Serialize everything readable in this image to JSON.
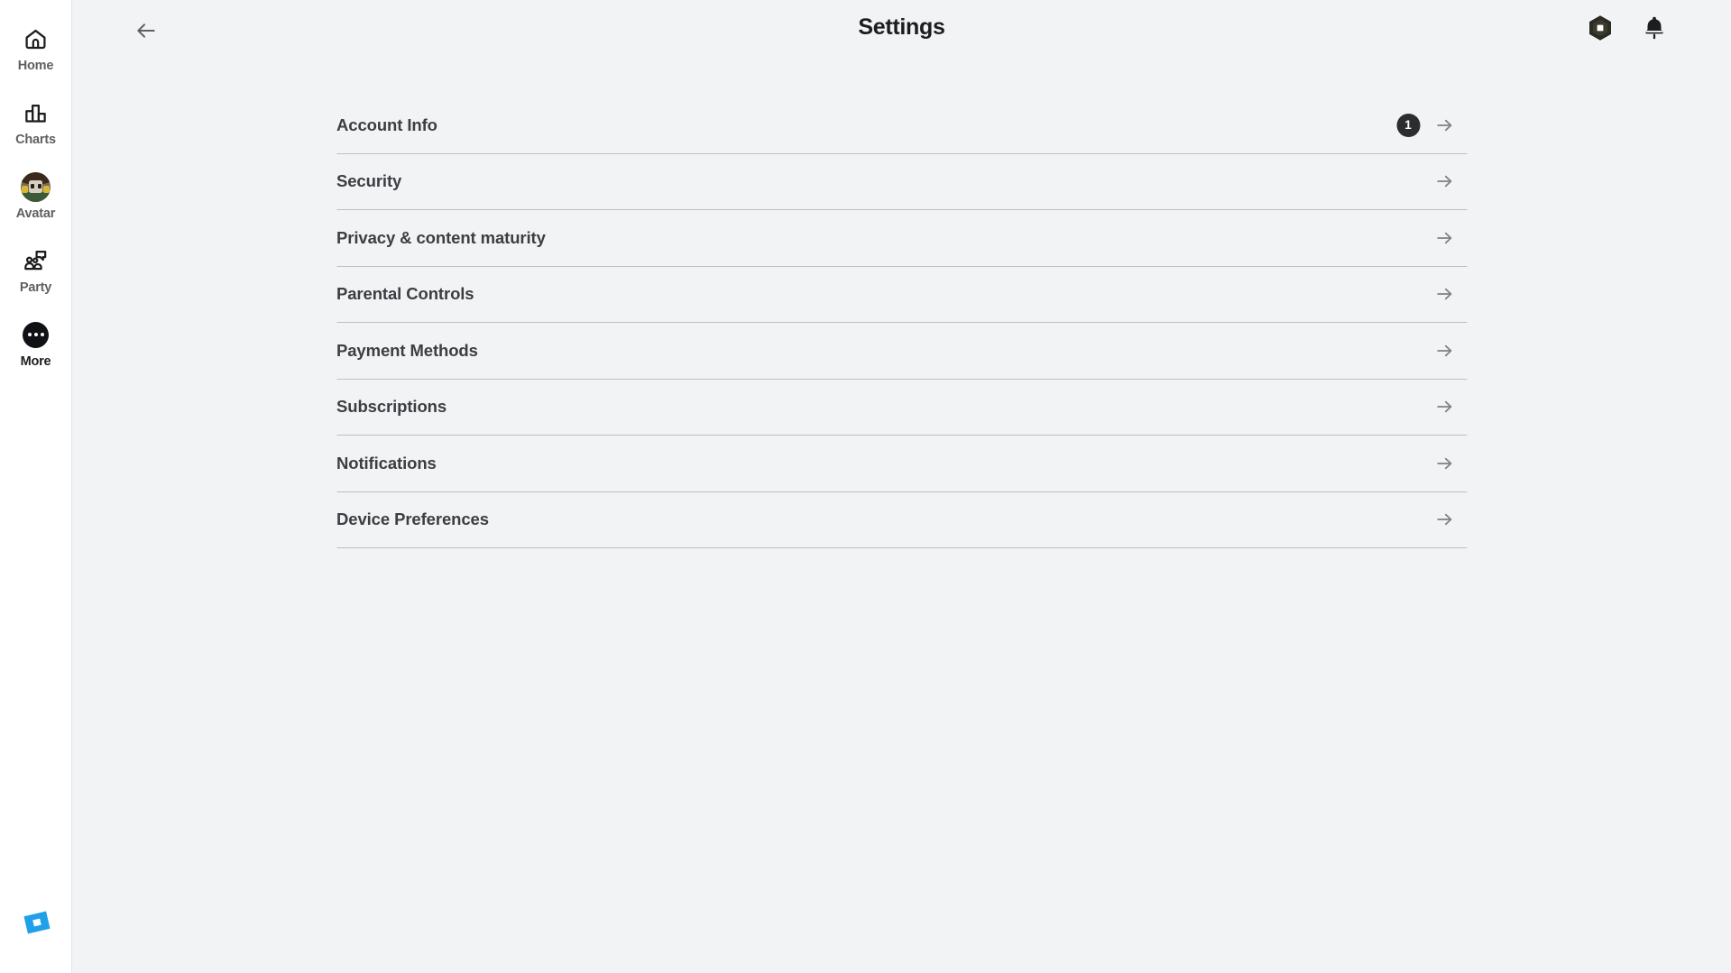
{
  "colors": {
    "page_bg": "#F2F3F4",
    "rail_bg": "#FFFFFF",
    "divider": "#BDC0C4",
    "title_text": "#1B1D1F",
    "row_text": "#3B3E42",
    "rail_label": "#5E6063",
    "badge_bg": "#2B2D30",
    "logo_blue": "#1FA0E8",
    "arrow_gray": "#7E8184"
  },
  "sidebar": {
    "items": [
      {
        "label": "Home",
        "icon": "home-icon",
        "active": false
      },
      {
        "label": "Charts",
        "icon": "charts-icon",
        "active": false
      },
      {
        "label": "Avatar",
        "icon": "avatar-icon",
        "active": false
      },
      {
        "label": "Party",
        "icon": "party-icon",
        "active": false
      },
      {
        "label": "More",
        "icon": "more-dots-icon",
        "active": true
      }
    ],
    "logo": "roblox-logo-icon"
  },
  "header": {
    "back_icon": "back-arrow-icon",
    "title": "Settings",
    "robux_icon": "robux-hexagon-icon",
    "notifications_icon": "notification-bell-icon"
  },
  "settings": {
    "rows": [
      {
        "label": "Account Info",
        "badge": "1",
        "arrow": "chevron-right-arrow-icon"
      },
      {
        "label": "Security",
        "badge": null,
        "arrow": "chevron-right-arrow-icon"
      },
      {
        "label": "Privacy & content maturity",
        "badge": null,
        "arrow": "chevron-right-arrow-icon"
      },
      {
        "label": "Parental Controls",
        "badge": null,
        "arrow": "chevron-right-arrow-icon"
      },
      {
        "label": "Payment Methods",
        "badge": null,
        "arrow": "chevron-right-arrow-icon"
      },
      {
        "label": "Subscriptions",
        "badge": null,
        "arrow": "chevron-right-arrow-icon"
      },
      {
        "label": "Notifications",
        "badge": null,
        "arrow": "chevron-right-arrow-icon"
      },
      {
        "label": "Device Preferences",
        "badge": null,
        "arrow": "chevron-right-arrow-icon"
      }
    ]
  }
}
